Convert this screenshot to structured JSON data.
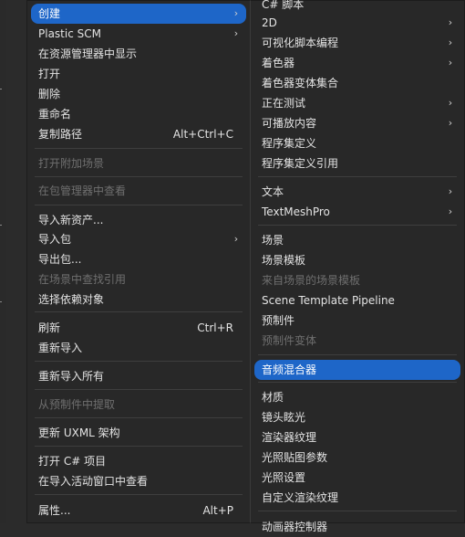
{
  "main_menu": {
    "items": [
      {
        "label": "创建",
        "shortcut": "",
        "submenu": true,
        "selected": true,
        "disabled": false
      },
      {
        "label": "Plastic SCM",
        "shortcut": "",
        "submenu": true,
        "selected": false,
        "disabled": false
      },
      {
        "label": "在资源管理器中显示",
        "shortcut": "",
        "submenu": false,
        "selected": false,
        "disabled": false
      },
      {
        "label": "打开",
        "shortcut": "",
        "submenu": false,
        "selected": false,
        "disabled": false
      },
      {
        "label": "删除",
        "shortcut": "",
        "submenu": false,
        "selected": false,
        "disabled": false
      },
      {
        "label": "重命名",
        "shortcut": "",
        "submenu": false,
        "selected": false,
        "disabled": false
      },
      {
        "label": "复制路径",
        "shortcut": "Alt+Ctrl+C",
        "submenu": false,
        "selected": false,
        "disabled": false
      },
      {
        "label": "打开附加场景",
        "shortcut": "",
        "submenu": false,
        "selected": false,
        "disabled": true
      },
      {
        "label": "在包管理器中查看",
        "shortcut": "",
        "submenu": false,
        "selected": false,
        "disabled": true
      },
      {
        "label": "导入新资产...",
        "shortcut": "",
        "submenu": false,
        "selected": false,
        "disabled": false
      },
      {
        "label": "导入包",
        "shortcut": "",
        "submenu": true,
        "selected": false,
        "disabled": false
      },
      {
        "label": "导出包...",
        "shortcut": "",
        "submenu": false,
        "selected": false,
        "disabled": false
      },
      {
        "label": "在场景中查找引用",
        "shortcut": "",
        "submenu": false,
        "selected": false,
        "disabled": true
      },
      {
        "label": "选择依赖对象",
        "shortcut": "",
        "submenu": false,
        "selected": false,
        "disabled": false
      },
      {
        "label": "刷新",
        "shortcut": "Ctrl+R",
        "submenu": false,
        "selected": false,
        "disabled": false
      },
      {
        "label": "重新导入",
        "shortcut": "",
        "submenu": false,
        "selected": false,
        "disabled": false
      },
      {
        "label": "重新导入所有",
        "shortcut": "",
        "submenu": false,
        "selected": false,
        "disabled": false
      },
      {
        "label": "从预制件中提取",
        "shortcut": "",
        "submenu": false,
        "selected": false,
        "disabled": true
      },
      {
        "label": "更新 UXML 架构",
        "shortcut": "",
        "submenu": false,
        "selected": false,
        "disabled": false
      },
      {
        "label": "打开 C# 项目",
        "shortcut": "",
        "submenu": false,
        "selected": false,
        "disabled": false
      },
      {
        "label": "在导入活动窗口中查看",
        "shortcut": "",
        "submenu": false,
        "selected": false,
        "disabled": false
      },
      {
        "label": "属性...",
        "shortcut": "Alt+P",
        "submenu": false,
        "selected": false,
        "disabled": false
      }
    ]
  },
  "sub_menu": {
    "items": [
      {
        "label": "C# 脚本",
        "submenu": false,
        "selected": false,
        "disabled": false
      },
      {
        "label": "2D",
        "submenu": true,
        "selected": false,
        "disabled": false
      },
      {
        "label": "可视化脚本编程",
        "submenu": true,
        "selected": false,
        "disabled": false
      },
      {
        "label": "着色器",
        "submenu": true,
        "selected": false,
        "disabled": false
      },
      {
        "label": "着色器变体集合",
        "submenu": false,
        "selected": false,
        "disabled": false
      },
      {
        "label": "正在测试",
        "submenu": true,
        "selected": false,
        "disabled": false
      },
      {
        "label": "可播放内容",
        "submenu": true,
        "selected": false,
        "disabled": false
      },
      {
        "label": "程序集定义",
        "submenu": false,
        "selected": false,
        "disabled": false
      },
      {
        "label": "程序集定义引用",
        "submenu": false,
        "selected": false,
        "disabled": false
      },
      {
        "label": "文本",
        "submenu": true,
        "selected": false,
        "disabled": false
      },
      {
        "label": "TextMeshPro",
        "submenu": true,
        "selected": false,
        "disabled": false
      },
      {
        "label": "场景",
        "submenu": false,
        "selected": false,
        "disabled": false
      },
      {
        "label": "场景模板",
        "submenu": false,
        "selected": false,
        "disabled": false
      },
      {
        "label": "来自场景的场景模板",
        "submenu": false,
        "selected": false,
        "disabled": true
      },
      {
        "label": "Scene Template Pipeline",
        "submenu": false,
        "selected": false,
        "disabled": false
      },
      {
        "label": "预制件",
        "submenu": false,
        "selected": false,
        "disabled": false
      },
      {
        "label": "预制件变体",
        "submenu": false,
        "selected": false,
        "disabled": true
      },
      {
        "label": "音频混合器",
        "submenu": false,
        "selected": true,
        "disabled": false
      },
      {
        "label": "材质",
        "submenu": false,
        "selected": false,
        "disabled": false
      },
      {
        "label": "镜头眩光",
        "submenu": false,
        "selected": false,
        "disabled": false
      },
      {
        "label": "渲染器纹理",
        "submenu": false,
        "selected": false,
        "disabled": false
      },
      {
        "label": "光照贴图参数",
        "submenu": false,
        "selected": false,
        "disabled": false
      },
      {
        "label": "光照设置",
        "submenu": false,
        "selected": false,
        "disabled": false
      },
      {
        "label": "自定义渲染纹理",
        "submenu": false,
        "selected": false,
        "disabled": false
      },
      {
        "label": "动画器控制器",
        "submenu": false,
        "selected": false,
        "disabled": false
      }
    ]
  }
}
